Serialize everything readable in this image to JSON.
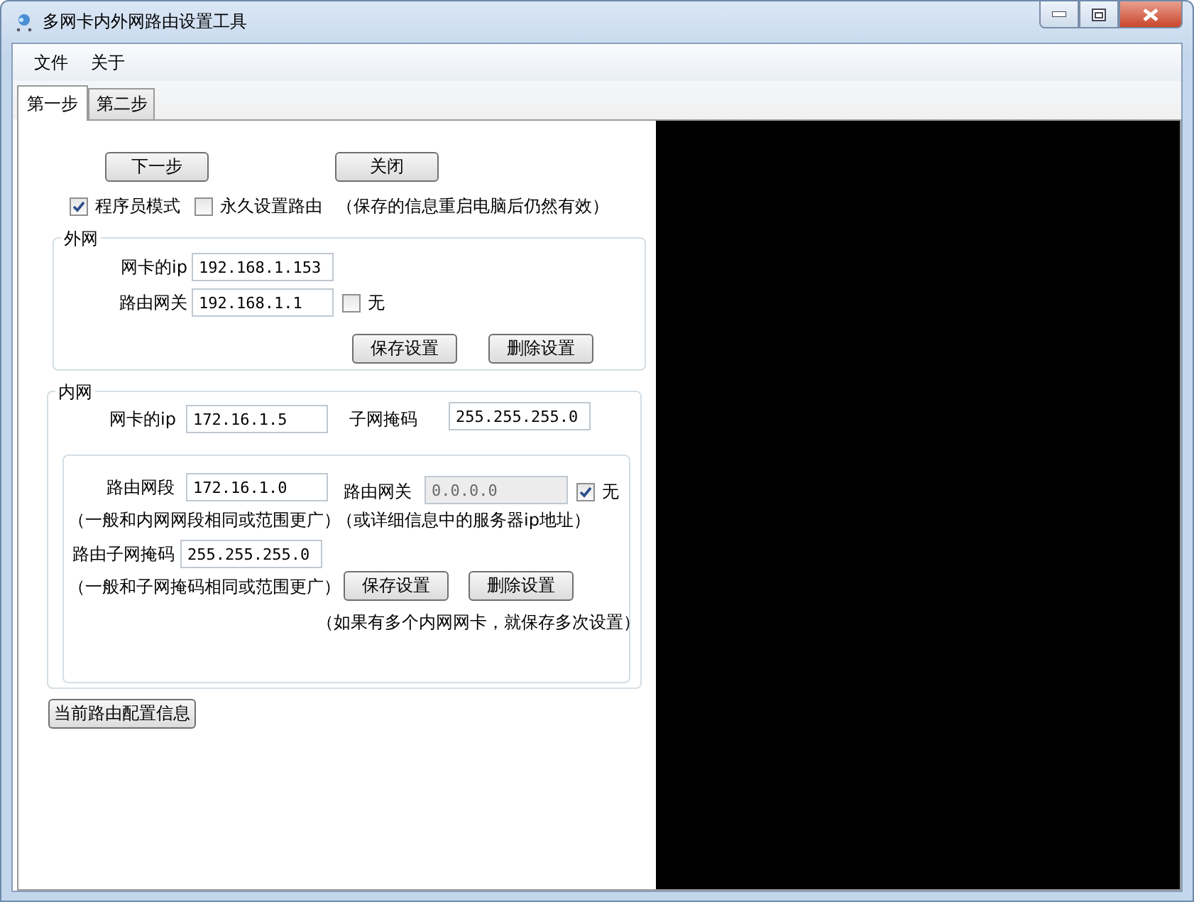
{
  "window": {
    "title": "多网卡内外网路由设置工具"
  },
  "menu": [
    {
      "label": "文件"
    },
    {
      "label": "关于"
    }
  ],
  "tabs": [
    {
      "label": "第一步",
      "selected": true
    },
    {
      "label": "第二步",
      "selected": false
    }
  ],
  "actions": [
    {
      "label": "下一步"
    },
    {
      "label": "关闭"
    }
  ],
  "options": [
    {
      "label": "程序员模式",
      "checked": true
    },
    {
      "label": "永久设置路由",
      "checked": false
    }
  ],
  "options_note": "（保存的信息重启电脑后仍然有效）",
  "external": {
    "title": "外网",
    "nic_ip": {
      "label": "网卡的ip",
      "value": "192.168.1.153"
    },
    "gateway": {
      "label": "路由网关",
      "value": "192.168.1.1",
      "disabled": false
    },
    "gateway_none": {
      "label": "无",
      "checked": false
    },
    "buttons": [
      "保存设置",
      "删除设置"
    ]
  },
  "internal": {
    "title": "内网",
    "nic_ip": {
      "label": "网卡的ip",
      "value": "172.16.1.5"
    },
    "subnet_mask": {
      "label": "子网掩码",
      "value": "255.255.255.0"
    },
    "route": {
      "segment": {
        "label": "路由网段",
        "value": "172.16.1.0"
      },
      "segment_hint": "（一般和内网网段相同或范围更广）",
      "gateway": {
        "label": "路由网关",
        "value": "0.0.0.0",
        "disabled": true
      },
      "gateway_none": {
        "label": "无",
        "checked": true
      },
      "gateway_hint": "（或详细信息中的服务器ip地址）",
      "mask": {
        "label": "路由子网掩码",
        "value": "255.255.255.0"
      },
      "mask_hint": "（一般和子网掩码相同或范围更广）",
      "buttons": [
        "保存设置",
        "删除设置"
      ],
      "buttons_hint": "（如果有多个内网网卡，就保存多次设置）"
    }
  },
  "info_button": "当前路由配置信息"
}
